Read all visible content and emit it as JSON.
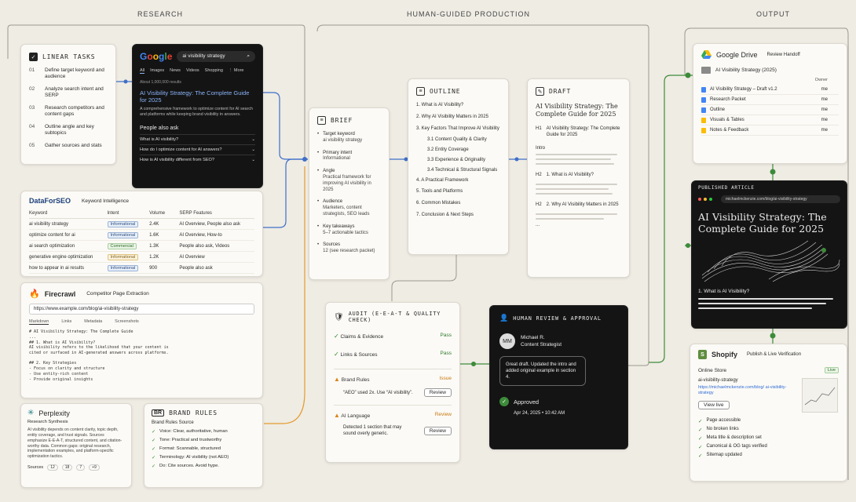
{
  "sections": {
    "research": "RESEARCH",
    "production": "HUMAN-GUIDED PRODUCTION",
    "output": "OUTPUT"
  },
  "linear": {
    "title": "LINEAR TASKS",
    "items": [
      {
        "num": "01",
        "text": "Define target keyword and audience"
      },
      {
        "num": "02",
        "text": "Analyze search intent and SERP"
      },
      {
        "num": "03",
        "text": "Research competitors and content gaps"
      },
      {
        "num": "04",
        "text": "Outline angle and key subtopics"
      },
      {
        "num": "05",
        "text": "Gather sources and stats"
      }
    ]
  },
  "google": {
    "logo": "Google",
    "query": "ai visibility strategy",
    "tabs": [
      "All",
      "Images",
      "News",
      "Videos",
      "Shopping",
      "⋮ More"
    ],
    "meta": "About 1,000,000 results",
    "result_title": "AI Visibility Strategy: The Complete Guide for 2025",
    "result_snippet": "A comprehensive framework to optimize content for AI search and platforms while keeping brand visibility in answers.",
    "paa_title": "People also ask",
    "paa": [
      "What is AI visibility?",
      "How do I optimize content for AI answers?",
      "How is AI visibility different from SEO?"
    ]
  },
  "dataforseo": {
    "logo": "DataForSEO",
    "subtitle": "Keyword Intelligence",
    "headers": [
      "Keyword",
      "Intent",
      "Volume",
      "SERP Features"
    ],
    "rows": [
      {
        "keyword": "ai visibility strategy",
        "intent": "Informational",
        "volume": "2.4K",
        "features": "AI Overview, People also ask"
      },
      {
        "keyword": "optimize content for ai",
        "intent": "Informational",
        "volume": "1.6K",
        "features": "AI Overview, How-to"
      },
      {
        "keyword": "ai search optimization",
        "intent": "Commercial",
        "volume": "1.3K",
        "features": "People also ask, Videos"
      },
      {
        "keyword": "generative engine optimization",
        "intent": "Informational",
        "volume": "1.2K",
        "features": "AI Overview"
      },
      {
        "keyword": "how to appear in ai results",
        "intent": "Informational",
        "volume": "900",
        "features": "People also ask"
      }
    ]
  },
  "firecrawl": {
    "logo": "Firecrawl",
    "subtitle": "Competitor Page Extraction",
    "url": "https://www.example.com/blog/ai-visibility-strategy",
    "tabs": [
      "Markdown",
      "Links",
      "Metadata",
      "Screenshots"
    ],
    "code": [
      "# AI Visibility Strategy: The Complete Guide",
      "...",
      "## 1. What is AI Visibility?",
      "AI visibility refers to the likelihood that your content is",
      "cited or surfaced in AI-generated answers across platforms.",
      "",
      "## 2. Key Strategies",
      "- Focus on clarity and structure",
      "- Use entity-rich content",
      "- Provide original insights"
    ]
  },
  "perplexity": {
    "logo": "Perplexity",
    "subtitle": "Research Synthesis",
    "text": "AI visibility depends on content clarity, topic depth, entity coverage, and trust signals. Sources emphasize E-E-A-T, structured content, and citation-worthy data. Common gaps: original research, implementation examples, and platform-specific optimization tactics.",
    "sources_label": "Sources",
    "sources": [
      "12",
      "18",
      "7",
      "+9"
    ]
  },
  "brand_rules": {
    "badge": "BR",
    "title": "BRAND RULES",
    "subtitle": "Brand Rules Source",
    "items": [
      "Voice: Clear, authoritative, human",
      "Tone: Practical and trustworthy",
      "Format: Scannable, structured",
      "Terminology: AI visibility (not AEO)",
      "Do: Cite sources. Avoid hype."
    ]
  },
  "brief": {
    "title": "BRIEF",
    "items": [
      {
        "label": "Target keyword",
        "value": "ai visibility strategy"
      },
      {
        "label": "Primary intent",
        "value": "Informational"
      },
      {
        "label": "Angle",
        "value": "Practical framework for improving AI visibility in 2025"
      },
      {
        "label": "Audience",
        "value": "Marketers, content strategists, SEO leads"
      },
      {
        "label": "Key takeaways",
        "value": "5–7 actionable tactics"
      },
      {
        "label": "Sources",
        "value": "12 (see research packet)"
      }
    ]
  },
  "outline": {
    "title": "OUTLINE",
    "items": [
      {
        "text": "1. What is AI Visibility?",
        "sub": false
      },
      {
        "text": "2. Why AI Visibility Matters in 2025",
        "sub": false
      },
      {
        "text": "3. Key Factors That Improve AI Visibility",
        "sub": false
      },
      {
        "text": "3.1 Content Quality & Clarity",
        "sub": true
      },
      {
        "text": "3.2 Entity Coverage",
        "sub": true
      },
      {
        "text": "3.3 Experience & Originality",
        "sub": true
      },
      {
        "text": "3.4 Technical & Structural Signals",
        "sub": true
      },
      {
        "text": "4. A Practical Framework",
        "sub": false
      },
      {
        "text": "5. Tools and Platforms",
        "sub": false
      },
      {
        "text": "6. Common Mistakes",
        "sub": false
      },
      {
        "text": "7. Conclusion & Next Steps",
        "sub": false
      }
    ]
  },
  "draft": {
    "title": "DRAFT",
    "heading": "AI Visibility Strategy: The Complete Guide for 2025",
    "h1_label": "H1",
    "h1_text": "AI Visibility Strategy: The Complete Guide for 2025",
    "intro": "Intro",
    "h2a_label": "H2",
    "h2a_text": "1. What is AI Visibility?",
    "h2b_label": "H2",
    "h2b_text": "2. Why AI Visibility Matters in 2025",
    "ellipsis": "..."
  },
  "audit": {
    "title": "AUDIT (E-E-A-T & QUALITY CHECK)",
    "checks": [
      {
        "label": "Claims & Evidence",
        "status": "Pass"
      },
      {
        "label": "Links & Sources",
        "status": "Pass"
      }
    ],
    "issue": {
      "label": "Brand Rules",
      "status": "Issue",
      "detail": "“AEO” used 2x. Use “AI visibility”.",
      "button": "Review"
    },
    "review": {
      "label": "AI Language",
      "status": "Review",
      "detail": "Detected 1 section that may sound overly generic.",
      "button": "Review"
    }
  },
  "human": {
    "title": "HUMAN REVIEW & APPROVAL",
    "avatar": "MM",
    "name": "Michael R.",
    "role": "Content Strategist",
    "comment": "Great draft. Updated the intro and added original example in section 4.",
    "approved": "Approved",
    "date": "Apr 24, 2025 • 10:42 AM"
  },
  "gdrive": {
    "logo": "Google Drive",
    "subtitle": "Review Handoff",
    "folder": "AI Visibility Strategy (2025)",
    "owner_header": "Owner",
    "files": [
      {
        "name": "AI Visibility Strategy – Draft v1.2",
        "owner": "me"
      },
      {
        "name": "Research Packet",
        "owner": "me"
      },
      {
        "name": "Outline",
        "owner": "me"
      },
      {
        "name": "Visuals & Tables",
        "owner": "me"
      },
      {
        "name": "Notes & Feedback",
        "owner": "me"
      }
    ]
  },
  "published": {
    "label": "PUBLISHED ARTICLE",
    "url": "michaelmckenzie.com/blog/ai-visibility-strategy",
    "heading": "AI Visibility Strategy: The Complete Guide for 2025",
    "subhead": "1. What is AI Visibility?"
  },
  "shopify": {
    "logo": "Shopify",
    "subtitle": "Publish & Live Verification",
    "store": "Online Store",
    "live": "Live",
    "handle": "ai-visibility-strategy",
    "link": "https://michaelmckenzie.com/blog/ ai-visibility-strategy",
    "button": "View live",
    "checks": [
      "Page accessible",
      "No broken links",
      "Meta title & description set",
      "Canonical & OG tags verified",
      "Sitemap updated"
    ]
  },
  "colors": {
    "accent_blue": "#2f6bd6",
    "accent_green": "#3d8b3a",
    "accent_orange": "#e59a2c"
  }
}
